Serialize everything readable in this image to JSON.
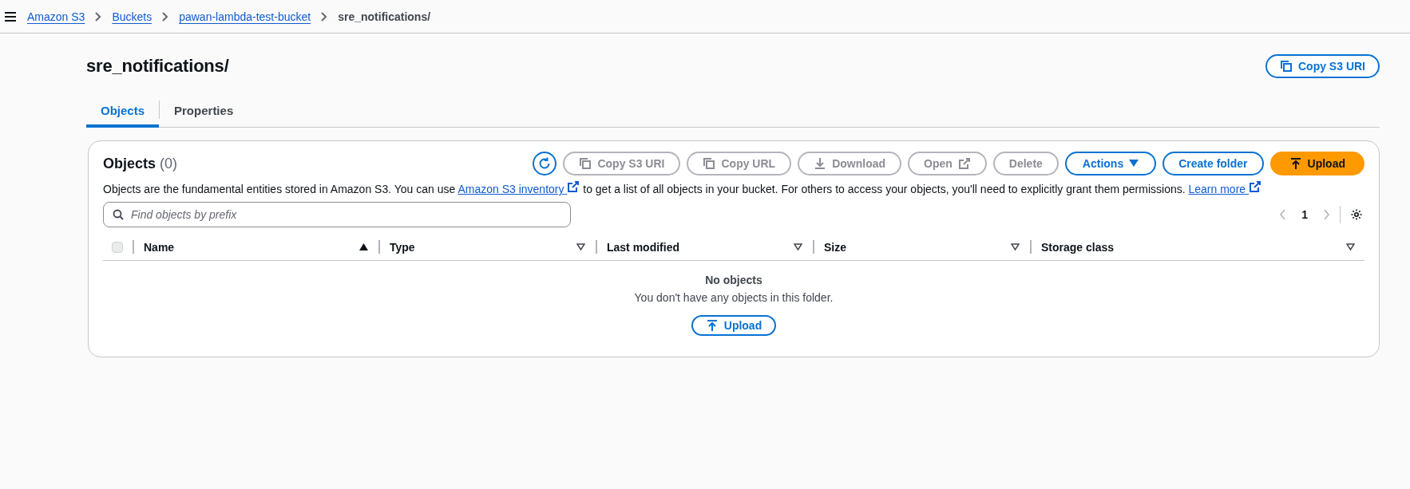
{
  "breadcrumbs": [
    {
      "label": "Amazon S3",
      "link": true
    },
    {
      "label": "Buckets",
      "link": true
    },
    {
      "label": "pawan-lambda-test-bucket",
      "link": true
    },
    {
      "label": "sre_notifications/",
      "link": false
    }
  ],
  "page": {
    "title": "sre_notifications/",
    "copy_button": "Copy S3 URI"
  },
  "tabs": [
    {
      "label": "Objects",
      "selected": true
    },
    {
      "label": "Properties",
      "selected": false
    }
  ],
  "panel": {
    "title": "Objects",
    "count": "(0)",
    "toolbar": [
      {
        "kind": "refresh",
        "disabled": false
      },
      {
        "kind": "copy",
        "label": "Copy S3 URI",
        "disabled": true
      },
      {
        "kind": "copy",
        "label": "Copy URL",
        "disabled": true
      },
      {
        "kind": "download",
        "label": "Download",
        "disabled": true
      },
      {
        "kind": "external",
        "label": "Open",
        "disabled": true
      },
      {
        "kind": "plain",
        "label": "Delete",
        "disabled": true
      },
      {
        "kind": "dropdown",
        "label": "Actions",
        "disabled": false
      },
      {
        "kind": "plain",
        "label": "Create folder",
        "disabled": false
      },
      {
        "kind": "primary",
        "label": "Upload",
        "disabled": false
      }
    ],
    "description": [
      {
        "kind": "text",
        "text": "Objects are the fundamental entities stored in Amazon S3. You can use "
      },
      {
        "kind": "link",
        "text": "Amazon S3 inventory"
      },
      {
        "kind": "text",
        "text": " to get a list of all objects in your bucket. For others to access your objects, you'll need to explicitly grant them permissions. "
      },
      {
        "kind": "link",
        "text": "Learn more"
      }
    ],
    "search": {
      "placeholder": "Find objects by prefix"
    },
    "pagination": {
      "page": "1"
    },
    "table": {
      "select_all": {
        "checked": false
      },
      "columns": [
        {
          "label": "Name",
          "sorted": true
        },
        {
          "label": "Type",
          "sorted": false
        },
        {
          "label": "Last modified",
          "sorted": false
        },
        {
          "label": "Size",
          "sorted": false
        },
        {
          "label": "Storage class",
          "sorted": false
        }
      ]
    },
    "empty": {
      "title": "No objects",
      "message": "You don't have any objects in this folder.",
      "button": "Upload"
    }
  }
}
